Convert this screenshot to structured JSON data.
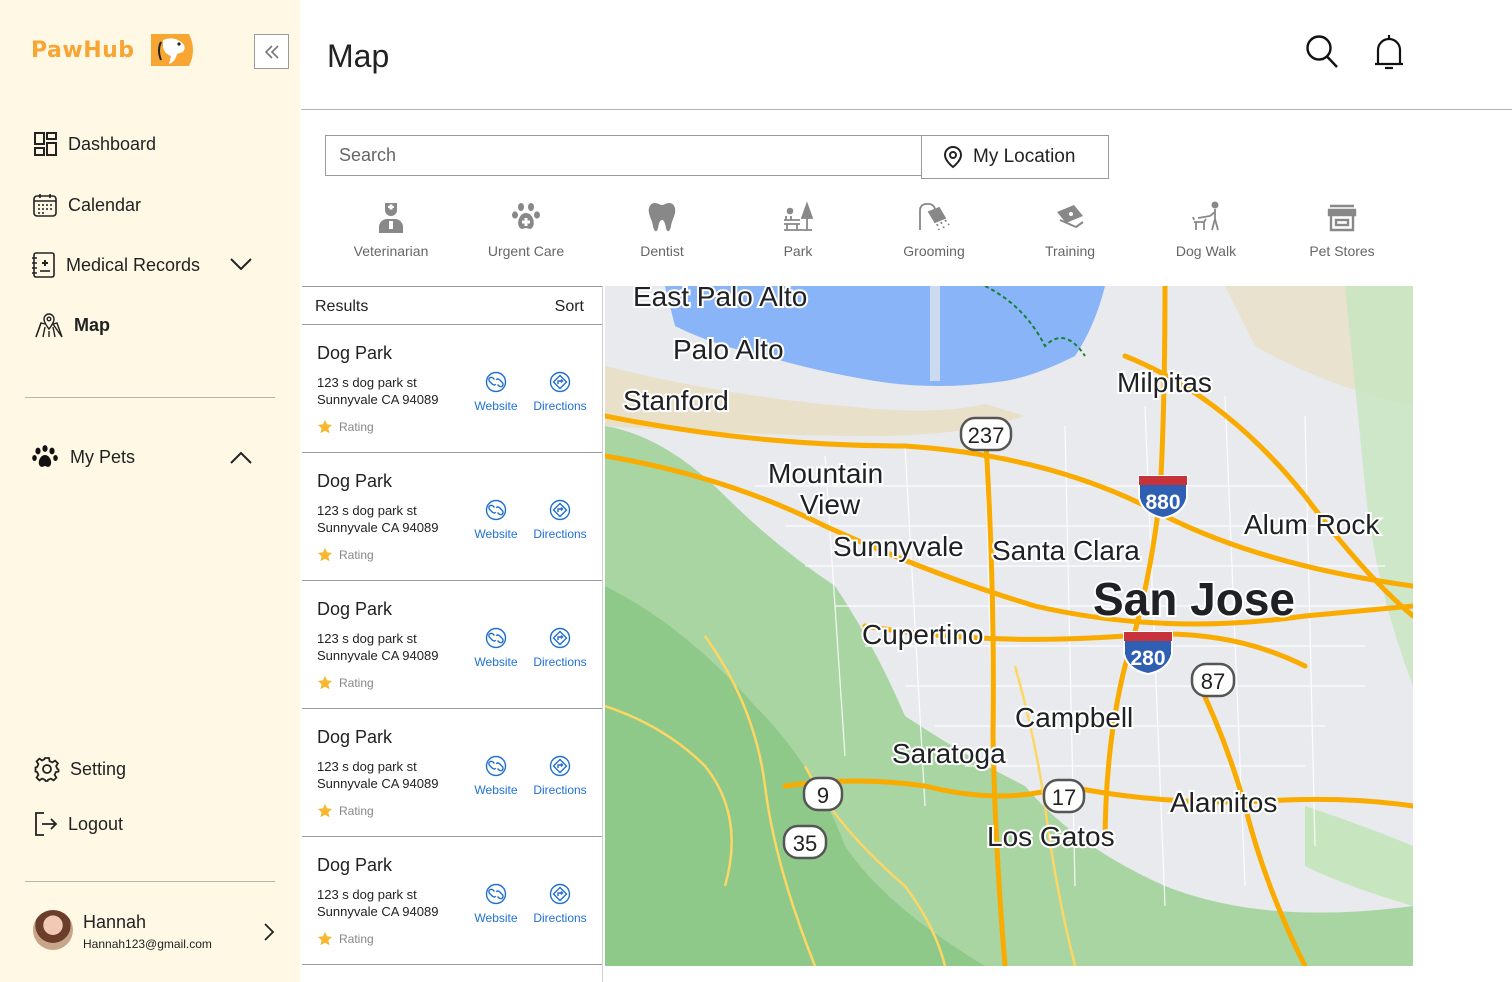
{
  "brand": {
    "name": "PawHub"
  },
  "sidebar": {
    "nav": [
      {
        "label": "Dashboard",
        "icon": "dashboard-icon"
      },
      {
        "label": "Calendar",
        "icon": "calendar-icon"
      },
      {
        "label": "Medical Records",
        "icon": "medical-records-icon"
      },
      {
        "label": "Map",
        "icon": "map-icon",
        "active": true
      }
    ],
    "pets_label": "My Pets",
    "bottom": [
      {
        "label": "Setting",
        "icon": "gear-icon"
      },
      {
        "label": "Logout",
        "icon": "logout-icon"
      }
    ],
    "user": {
      "name": "Hannah",
      "email": "Hannah123@gmail.com"
    }
  },
  "header": {
    "title": "Map"
  },
  "search": {
    "placeholder": "Search",
    "location_button": "My Location"
  },
  "categories": [
    {
      "label": "Veterinarian",
      "icon": "veterinarian-icon"
    },
    {
      "label": "Urgent Care",
      "icon": "paw-plus-icon"
    },
    {
      "label": "Dentist",
      "icon": "tooth-icon"
    },
    {
      "label": "Park",
      "icon": "park-icon"
    },
    {
      "label": "Grooming",
      "icon": "shower-icon"
    },
    {
      "label": "Training",
      "icon": "training-icon"
    },
    {
      "label": "Dog Walk",
      "icon": "dog-walk-icon"
    },
    {
      "label": "Pet Stores",
      "icon": "store-icon"
    }
  ],
  "results": {
    "title": "Results",
    "sort_label": "Sort",
    "items": [
      {
        "name": "Dog Park",
        "address1": "123 s dog park st",
        "address2": "Sunnyvale CA 94089",
        "website": "Website",
        "directions": "Directions",
        "rating": "Rating"
      },
      {
        "name": "Dog Park",
        "address1": "123 s dog park st",
        "address2": "Sunnyvale CA 94089",
        "website": "Website",
        "directions": "Directions",
        "rating": "Rating"
      },
      {
        "name": "Dog Park",
        "address1": "123 s dog park st",
        "address2": "Sunnyvale CA 94089",
        "website": "Website",
        "directions": "Directions",
        "rating": "Rating"
      },
      {
        "name": "Dog Park",
        "address1": "123 s dog park st",
        "address2": "Sunnyvale CA 94089",
        "website": "Website",
        "directions": "Directions",
        "rating": "Rating"
      },
      {
        "name": "Dog Park",
        "address1": "123 s dog park st",
        "address2": "Sunnyvale CA 94089",
        "website": "Website",
        "directions": "Directions",
        "rating": "Rating"
      }
    ]
  },
  "map": {
    "cities": [
      "East Palo Alto",
      "Palo Alto",
      "Stanford",
      "Milpitas",
      "Mountain",
      "View",
      "Sunnyvale",
      "Santa Clara",
      "Alum Rock",
      "San Jose",
      "Cupertino",
      "Campbell",
      "Saratoga",
      "Alamitos",
      "Los Gatos"
    ],
    "shields": [
      "237",
      "880",
      "280",
      "87",
      "9",
      "17",
      "35"
    ]
  }
}
